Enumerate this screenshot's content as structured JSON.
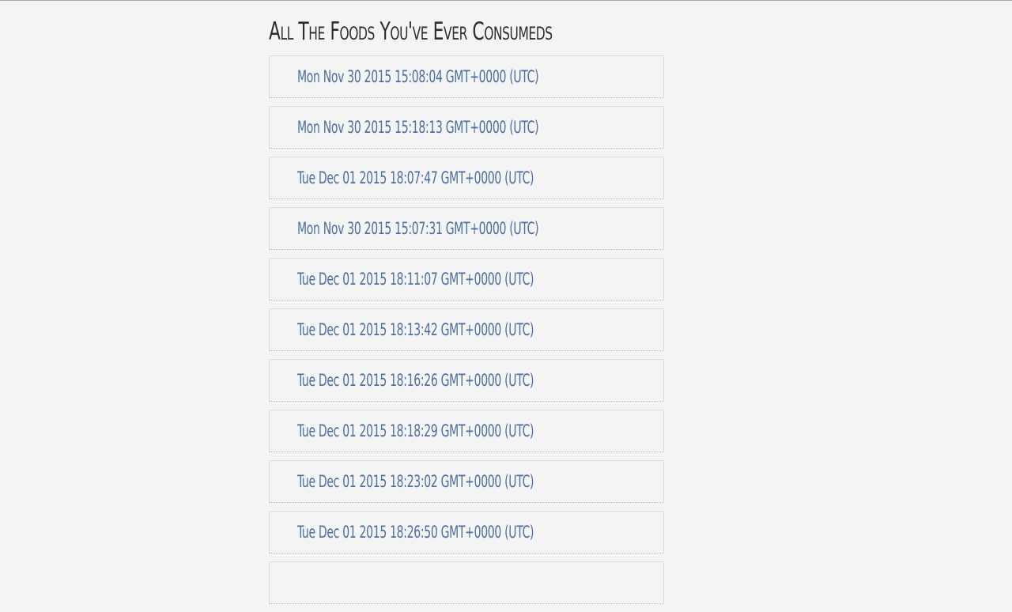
{
  "page": {
    "title": "All The Foods You've Ever Consumeds"
  },
  "entries": [
    {
      "label": "Mon Nov 30 2015 15:08:04 GMT+0000 (UTC)"
    },
    {
      "label": "Mon Nov 30 2015 15:18:13 GMT+0000 (UTC)"
    },
    {
      "label": "Tue Dec 01 2015 18:07:47 GMT+0000 (UTC)"
    },
    {
      "label": "Mon Nov 30 2015 15:07:31 GMT+0000 (UTC)"
    },
    {
      "label": "Tue Dec 01 2015 18:11:07 GMT+0000 (UTC)"
    },
    {
      "label": "Tue Dec 01 2015 18:13:42 GMT+0000 (UTC)"
    },
    {
      "label": "Tue Dec 01 2015 18:16:26 GMT+0000 (UTC)"
    },
    {
      "label": "Tue Dec 01 2015 18:18:29 GMT+0000 (UTC)"
    },
    {
      "label": "Tue Dec 01 2015 18:23:02 GMT+0000 (UTC)"
    },
    {
      "label": "Tue Dec 01 2015 18:26:50 GMT+0000 (UTC)"
    },
    {
      "label": ""
    }
  ]
}
